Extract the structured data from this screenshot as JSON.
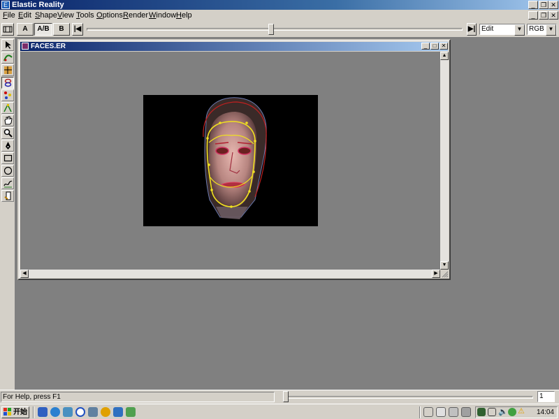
{
  "app": {
    "title": "Elastic Reality"
  },
  "menu": {
    "items": [
      {
        "label": "File",
        "u": "F",
        "rest": "ile"
      },
      {
        "label": "Edit",
        "u": "E",
        "rest": "dit"
      },
      {
        "label": "Shape",
        "u": "S",
        "rest": "hape"
      },
      {
        "label": "View",
        "u": "V",
        "rest": "iew"
      },
      {
        "label": "Tools",
        "u": "T",
        "rest": "ools"
      },
      {
        "label": "Options",
        "u": "O",
        "rest": "ptions"
      },
      {
        "label": "Render",
        "u": "R",
        "rest": "ender"
      },
      {
        "label": "Window",
        "u": "W",
        "rest": "indow"
      },
      {
        "label": "Help",
        "u": "H",
        "rest": "elp"
      }
    ]
  },
  "toolbar": {
    "a_label": "A",
    "ab_label": "A/B",
    "b_label": "B",
    "mode_value": "Edit",
    "channel_value": "RGB",
    "timeline_position": 0.49
  },
  "tools": [
    "pointer-icon",
    "shape-icon",
    "correspondence-icon",
    "link-icon",
    "point-icon",
    "edit-icon",
    "hand-icon",
    "zoom-icon",
    "pen-icon",
    "rectangle-icon",
    "oval-icon",
    "freehand-icon",
    "transform-icon"
  ],
  "document": {
    "title": "FACES.ER"
  },
  "status": {
    "help_text": "For Help, press F1",
    "frame_value": "1",
    "slider_position": 0.0
  },
  "taskbar": {
    "start_label": "开始",
    "clock": "14:04"
  },
  "colors": {
    "title_active": "#0a246a",
    "face_outline": "#f0e020",
    "face_contour": "#c02020",
    "workspace": "#808080"
  }
}
